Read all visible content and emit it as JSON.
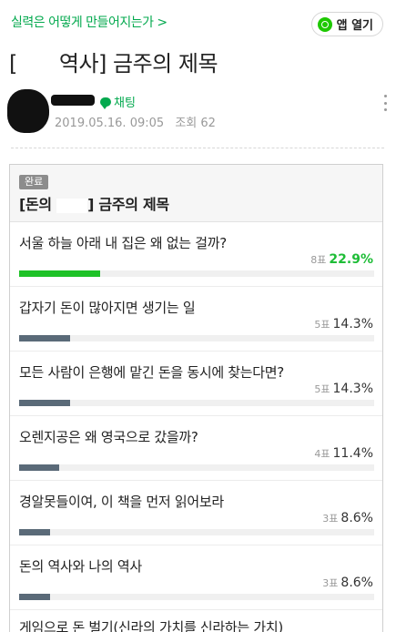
{
  "header": {
    "cafe_link": "실력은 어떻게 만들어지는가 >",
    "open_app": "앱 열기"
  },
  "post": {
    "title_prefix": "[",
    "title_rest": "역사] 금주의 제목",
    "chat_label": "채팅",
    "date": "2019.05.16. 09:05",
    "views": "조회 62"
  },
  "vote": {
    "badge": "완료",
    "title_prefix": "[돈의",
    "title_rest": "] 금주의 제목",
    "items": [
      {
        "label": "서울 하늘 아래 내 집은 왜 없는 걸까?",
        "count": "8표",
        "pct": "22.9%",
        "ratio": 0.229
      },
      {
        "label": "갑자기 돈이 많아지면 생기는 일",
        "count": "5표",
        "pct": "14.3%",
        "ratio": 0.143
      },
      {
        "label": "모든 사람이 은행에 맡긴 돈을 동시에 찾는다면?",
        "count": "5표",
        "pct": "14.3%",
        "ratio": 0.143
      },
      {
        "label": "오렌지공은 왜 영국으로 갔을까?",
        "count": "4표",
        "pct": "11.4%",
        "ratio": 0.114
      },
      {
        "label": "경알못들이여, 이 책을 먼저 읽어보라",
        "count": "3표",
        "pct": "8.6%",
        "ratio": 0.086
      },
      {
        "label": "돈의 역사와 나의 역사",
        "count": "3표",
        "pct": "8.6%",
        "ratio": 0.086
      },
      {
        "label": "게임으로 돈 벌기(신라의 가치를 신라하는 가치)",
        "count": "",
        "pct": "",
        "ratio": 0
      }
    ]
  },
  "colors": {
    "brand_green": "#03a94e",
    "top_bar": "#1ec227",
    "bar": "#5a6a78"
  }
}
